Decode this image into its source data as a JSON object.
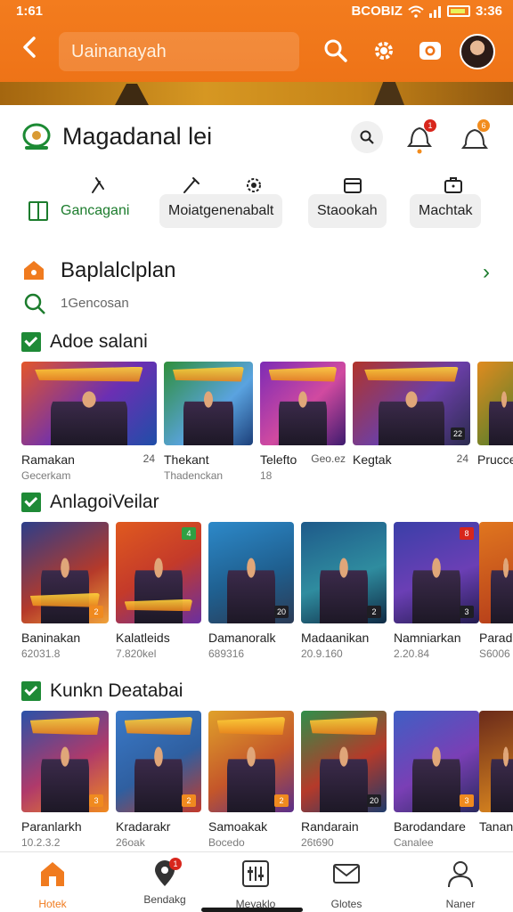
{
  "status": {
    "time": "1:61",
    "right_text": "BCOBIZ",
    "clock_right": "3:36"
  },
  "search": {
    "placeholder": "Uainanayah"
  },
  "brand": {
    "title": "Magadanal lei"
  },
  "categories": [
    {
      "label": "Gancagani",
      "active": true
    },
    {
      "label": "Moiatgenenabalt",
      "active": false
    },
    {
      "label": "Staookah",
      "active": false
    },
    {
      "label": "Machtak",
      "active": false
    }
  ],
  "recommend": {
    "title": "Baplalclplan",
    "subtitle": "1Gencosan"
  },
  "badges": {
    "bell_count": "1",
    "notif_count": "6"
  },
  "sections": [
    {
      "title": "Adoe salani",
      "items": [
        {
          "name": "Ramakan",
          "meta": "Gecerkam",
          "num": "24"
        },
        {
          "name": "Thekant",
          "meta": "Thadenckan",
          "num": ""
        },
        {
          "name": "Telefto",
          "meta": "18",
          "num": "Geo.ez"
        },
        {
          "name": "Kegtak",
          "meta": "",
          "num": "24"
        },
        {
          "name": "Prucce",
          "meta": "",
          "num": ""
        }
      ]
    },
    {
      "title": "AnlagoiVeilar",
      "items": [
        {
          "name": "Baninakan",
          "meta": "62031.8"
        },
        {
          "name": "Kalatleids",
          "meta": "7.820kel"
        },
        {
          "name": "Damanoralk",
          "meta": "689316"
        },
        {
          "name": "Madaanikan",
          "meta": "20.9.160"
        },
        {
          "name": "Namniarkan",
          "meta": "2.20.84"
        },
        {
          "name": "Parad",
          "meta": "S6006"
        }
      ]
    },
    {
      "title": "Kunkn Deatabai",
      "items": [
        {
          "name": "Paranlarkh",
          "meta": "10.2.3.2"
        },
        {
          "name": "Kradarakr",
          "meta": "26oak"
        },
        {
          "name": "Samoakak",
          "meta": "Bocedo"
        },
        {
          "name": "Randarain",
          "meta": "26t690"
        },
        {
          "name": "Barodandare",
          "meta": "Canalee"
        },
        {
          "name": "Tanan",
          "meta": ""
        }
      ]
    }
  ],
  "bottom_nav": [
    {
      "label": "Hotek",
      "active": true
    },
    {
      "label": "Bendakg",
      "active": false
    },
    {
      "label": "Meyaklo",
      "active": false
    },
    {
      "label": "Glotes",
      "active": false
    },
    {
      "label": "Naner",
      "active": false
    }
  ],
  "colors": {
    "accent": "#f07b1f",
    "green": "#1c7c2d",
    "badge_red": "#d8261c"
  }
}
